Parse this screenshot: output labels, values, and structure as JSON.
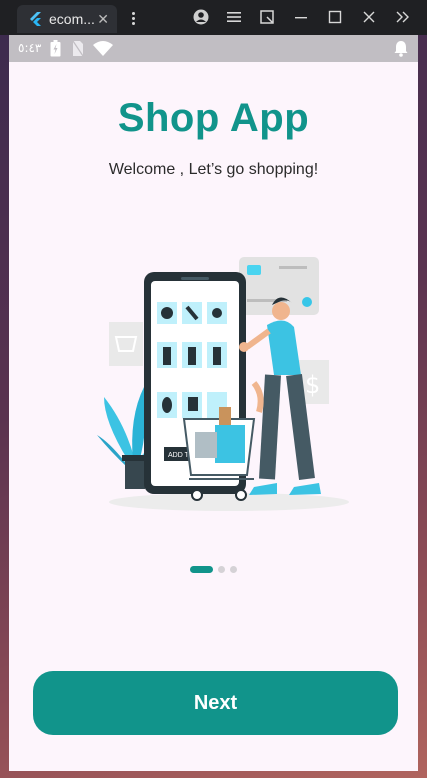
{
  "window": {
    "tab_title": "ecom...",
    "tab_close": "✕"
  },
  "statusbar": {
    "time": "٥:٤٣"
  },
  "onboarding": {
    "title": "Shop App",
    "subtitle": "Welcome , Let’s go shopping!",
    "illustration_caption": "ADD TO CART",
    "page_count": 3,
    "current_page": 1
  },
  "actions": {
    "next_label": "Next"
  },
  "colors": {
    "accent": "#11948b",
    "background": "#fdf5fc",
    "statusbar": "#c1bec3"
  }
}
